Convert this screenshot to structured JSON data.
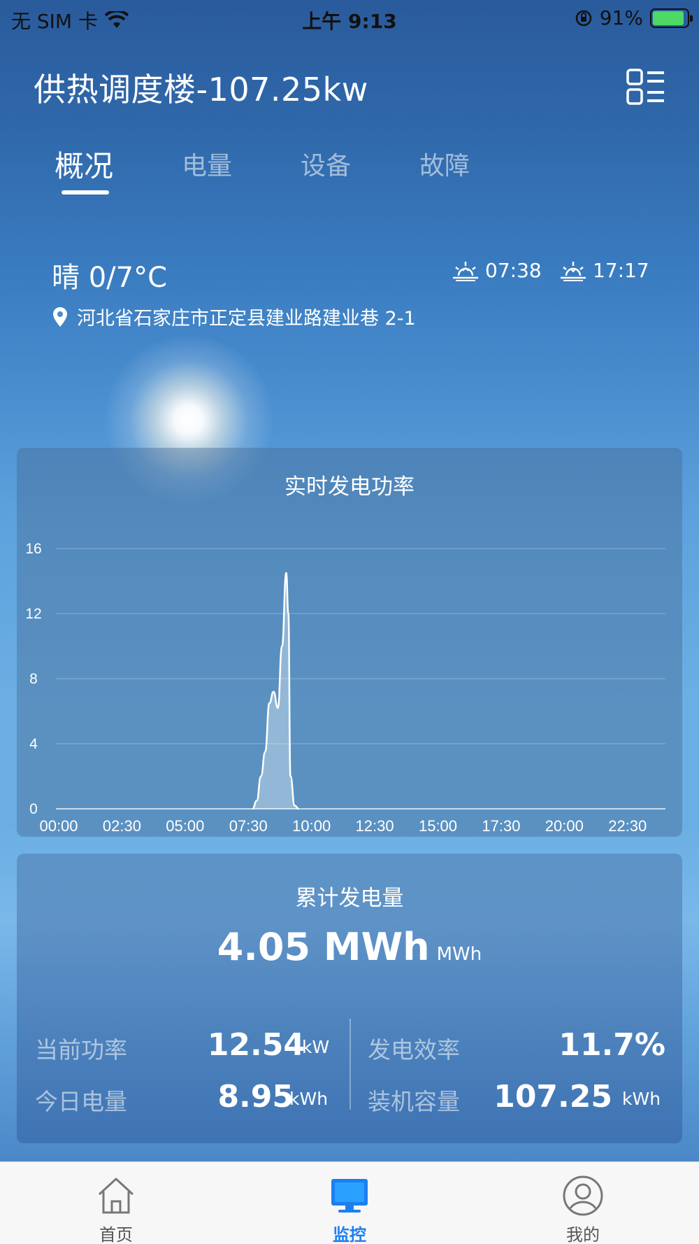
{
  "status_bar": {
    "carrier": "无 SIM 卡",
    "time": "上午 9:13",
    "battery": "91%",
    "battery_level": 0.91
  },
  "header": {
    "title": "供热调度楼-107.25kw",
    "menu_icon": "grid-list-icon"
  },
  "tabs": [
    {
      "label": "概况",
      "active": true
    },
    {
      "label": "电量",
      "active": false
    },
    {
      "label": "设备",
      "active": false
    },
    {
      "label": "故障",
      "active": false
    }
  ],
  "weather": {
    "summary": "晴 0/7°C",
    "sunrise": "07:38",
    "sunset": "17:17",
    "address": "河北省石家庄市正定县建业路建业巷 2-1"
  },
  "realtime_card": {
    "title": "实时发电功率"
  },
  "chart_data": {
    "type": "area",
    "title": "实时发电功率",
    "xlabel": "",
    "ylabel": "",
    "ylim": [
      0,
      16
    ],
    "yticks": [
      "0",
      "4",
      "8",
      "12",
      "16"
    ],
    "xtick_labels": [
      "00:00",
      "02:30",
      "05:00",
      "07:30",
      "10:00",
      "12:30",
      "15:00",
      "17:30",
      "20:00",
      "22:30"
    ],
    "xlim_hours": [
      0,
      24
    ],
    "grid": true,
    "x": [
      "07:40",
      "07:50",
      "08:00",
      "08:10",
      "08:20",
      "08:30",
      "08:40",
      "08:50",
      "09:00",
      "09:05",
      "09:10",
      "09:20",
      "09:30"
    ],
    "values": [
      0,
      0.5,
      2.0,
      3.5,
      6.5,
      7.2,
      6.2,
      10.0,
      14.5,
      12.0,
      2.0,
      0.2,
      0
    ],
    "line_color": "#ffffff"
  },
  "stats_card": {
    "title": "累计发电量",
    "total_value": "4.05 MWh",
    "total_unit": "MWh",
    "items": [
      {
        "label": "当前功率",
        "value": "12.54",
        "unit": "kW"
      },
      {
        "label": "今日电量",
        "value": "8.95",
        "unit": "kWh"
      },
      {
        "label": "发电效率",
        "value": "11.7%",
        "unit": ""
      },
      {
        "label": "装机容量",
        "value": "107.25",
        "unit": "kWh"
      }
    ]
  },
  "tab_bar": [
    {
      "label": "首页",
      "icon": "home-icon",
      "active": false
    },
    {
      "label": "监控",
      "icon": "monitor-icon",
      "active": true
    },
    {
      "label": "我的",
      "icon": "user-icon",
      "active": false
    }
  ],
  "colors": {
    "accent": "#1c7ff0",
    "tabbar_bg": "#f7f7f7"
  }
}
